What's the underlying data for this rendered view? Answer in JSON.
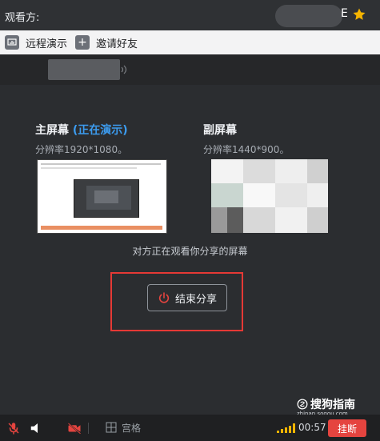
{
  "title_bar": {
    "glyph": "E"
  },
  "toolbar": {
    "remote_demo_label": "远程演示",
    "invite_friend_label": "邀请好友"
  },
  "viewer_bar": {
    "label": "观看方:"
  },
  "screens": {
    "primary": {
      "title": "主屏幕",
      "status": "(正在演示)",
      "resolution": "分辨率1920*1080。"
    },
    "secondary": {
      "title": "副屏幕",
      "resolution": "分辨率1440*900。"
    }
  },
  "notice_text": "对方正在观看你分享的屏幕",
  "stop_share_label": "结束分享",
  "bottom_bar": {
    "grid_label": "宫格",
    "timer": "00:57",
    "hangup_label": "挂断"
  },
  "watermark": {
    "brand": "搜狗指南",
    "site": "zhinan.sogou.com"
  },
  "colors": {
    "accent_blue": "#3c9cf0",
    "danger_red": "#e53935",
    "hangup_red": "#e5443f",
    "star_yellow": "#f5b400"
  }
}
